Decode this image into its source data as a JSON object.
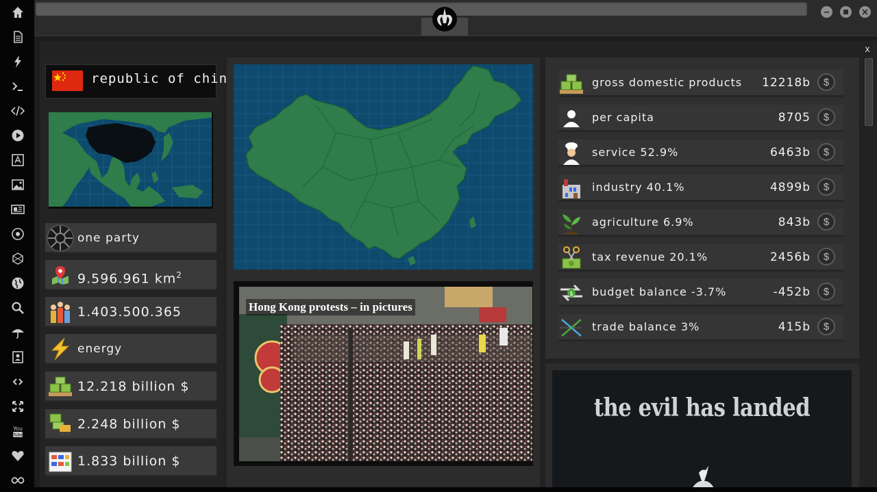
{
  "country": {
    "name": "republic of china",
    "flag_color": "#de2910"
  },
  "left_stats": [
    {
      "icon": "imperial-emblem-icon",
      "text": "one party"
    },
    {
      "icon": "area-map-pin-icon",
      "text": "9.596.961 km",
      "sup": "2"
    },
    {
      "icon": "population-icon",
      "text": "1.403.500.365"
    },
    {
      "icon": "energy-bolt-icon",
      "text": "energy"
    },
    {
      "icon": "money-stack-icon",
      "text": "12.218 billion $"
    },
    {
      "icon": "export-forklift-icon",
      "text": "2.248 billion $"
    },
    {
      "icon": "import-boxes-icon",
      "text": "1.833 billion $"
    }
  ],
  "news": {
    "headline": "Hong Kong protests – in pictures"
  },
  "economy": [
    {
      "icon": "money-stack-icon",
      "label": "gross domestic products",
      "value": "12218b"
    },
    {
      "icon": "person-icon",
      "label": "per capita",
      "value": "8705"
    },
    {
      "icon": "chef-icon",
      "label": "service 52.9%",
      "value": "6463b"
    },
    {
      "icon": "factory-icon",
      "label": "industry 40.1%",
      "value": "4899b"
    },
    {
      "icon": "plant-sprout-icon",
      "label": "agriculture 6.9%",
      "value": "843b"
    },
    {
      "icon": "tax-scissors-icon",
      "label": "tax revenue 20.1%",
      "value": "2456b"
    },
    {
      "icon": "budget-arrows-icon",
      "label": "budget balance -3.7%",
      "value": "-452b"
    },
    {
      "icon": "trade-cross-icon",
      "label": "trade balance 3%",
      "value": "415b"
    }
  ],
  "coin_symbol": "$",
  "ad": {
    "title": "the evil has landed"
  },
  "window": {
    "close_label": "x"
  },
  "rail_icons": [
    "home-icon",
    "document-icon",
    "lightning-icon",
    "terminal-icon",
    "code-icon",
    "play-icon",
    "translate-icon",
    "image-icon",
    "newspaper-icon",
    "rebel-emblem-icon",
    "network-icon",
    "globe-icon",
    "search-icon",
    "umbrella-icon",
    "contacts-icon",
    "link-icon",
    "expand-icon",
    "youtube-icon",
    "heart-icon",
    "infinity-icon"
  ],
  "colors": {
    "map_ocean": "#0d4a6e",
    "map_land": "#2e7d4a",
    "china_highlight": "#0a0f14",
    "flag_red": "#de2910"
  }
}
